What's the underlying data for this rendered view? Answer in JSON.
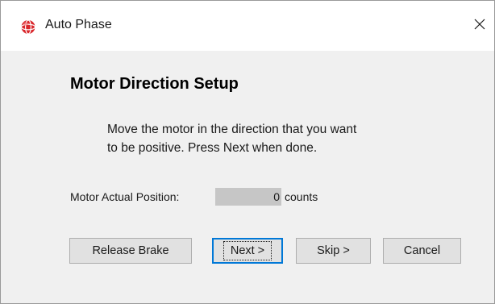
{
  "window": {
    "title": "Auto Phase",
    "app_icon": "app-logo-icon",
    "close_icon": "close-icon"
  },
  "heading": "Motor Direction Setup",
  "instructions": {
    "line1": "Move the motor in the direction that you want",
    "line2": "to be positive.  Press Next when done."
  },
  "position": {
    "label": "Motor Actual Position:",
    "value": "0",
    "units": "counts"
  },
  "buttons": {
    "release_brake": "Release Brake",
    "next": "Next >",
    "skip": "Skip >",
    "cancel": "Cancel"
  },
  "colors": {
    "accent": "#0078d7",
    "app_icon_red": "#d9262b",
    "dialog_bg": "#f0f0f0",
    "readout_bg": "#c6c6c6"
  }
}
